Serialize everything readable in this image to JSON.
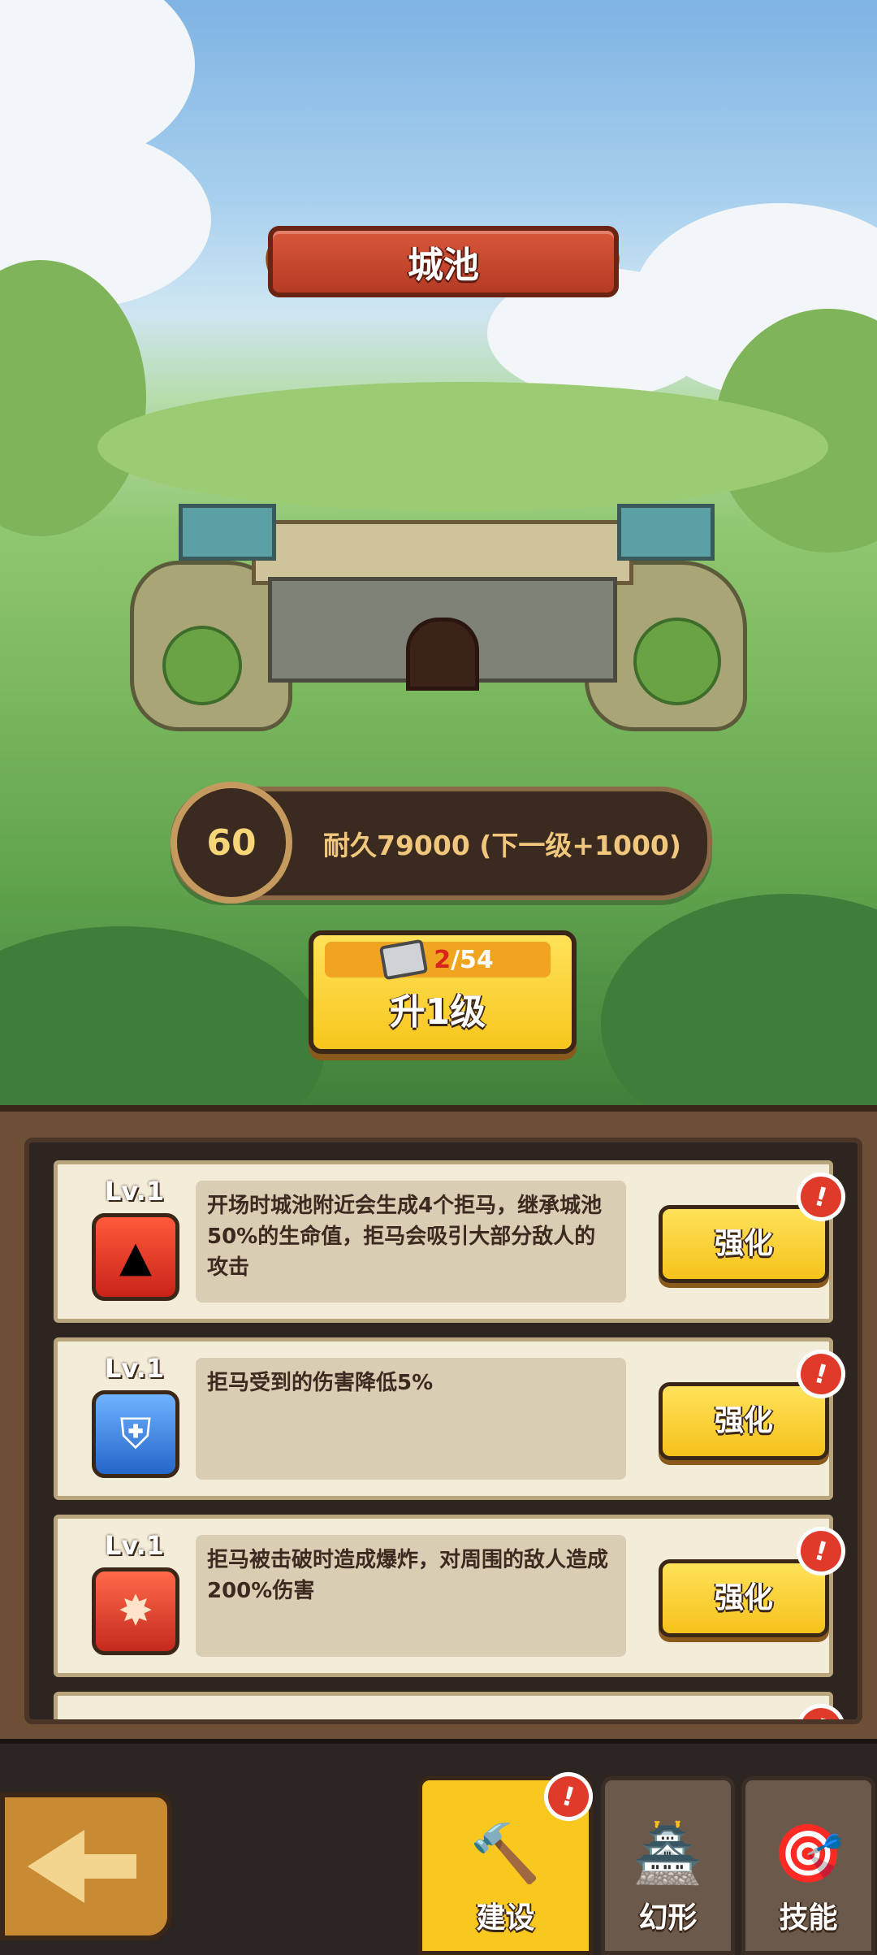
{
  "title": "城池",
  "level": "60",
  "durability_text": "耐久79000 (下一级+1000)",
  "upgrade": {
    "cost_have": "2",
    "cost_need": "/54",
    "label": "升1级"
  },
  "skills": [
    {
      "level": "Lv.1",
      "description": "开场时城池附近会生成4个拒马，继承城池50%的生命值，拒马会吸引大部分敌人的攻击",
      "button": "强化",
      "icon": "spikes-icon"
    },
    {
      "level": "Lv.1",
      "description": "拒马受到的伤害降低5%",
      "button": "强化",
      "icon": "shield-icon"
    },
    {
      "level": "Lv.1",
      "description": "拒马被击破时造成爆炸，对周围的敌人造成200%伤害",
      "button": "强化",
      "icon": "explosion-icon"
    }
  ],
  "nav": {
    "build": "建设",
    "morph": "幻形",
    "skill": "技能"
  },
  "colors": {
    "accent_yellow": "#f8c81e",
    "title_red": "#c8472d",
    "badge_red": "#e03b2a"
  }
}
